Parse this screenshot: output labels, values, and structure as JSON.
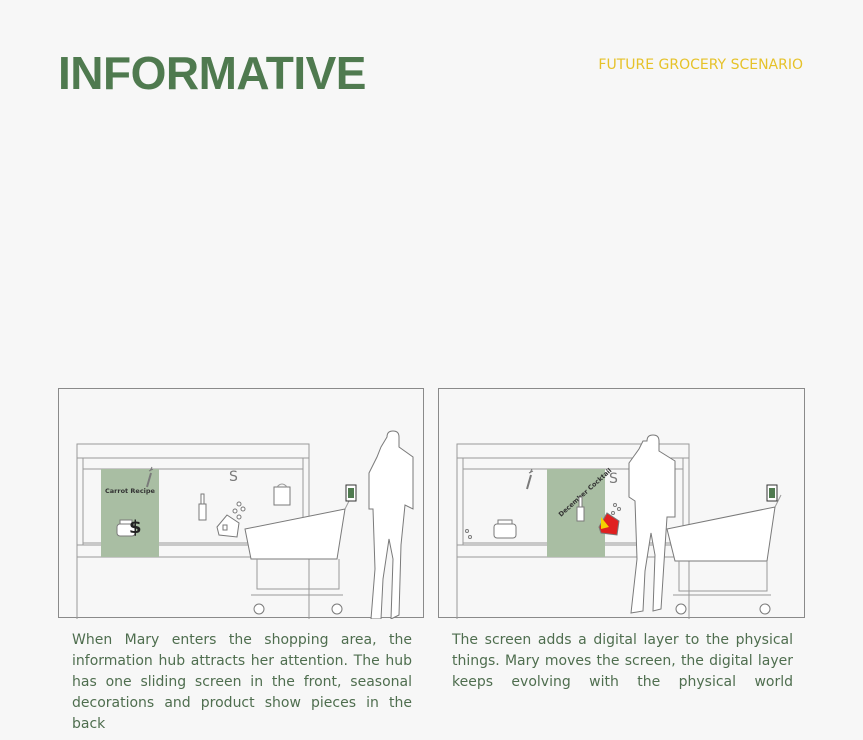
{
  "header": {
    "title": "INFORMATIVE",
    "subtitle": "FUTURE GROCERY SCENARIO"
  },
  "panels": [
    {
      "screen_label": "Carrot Recipe",
      "caption": "When Mary enters the shopping area, the information hub attracts her attention. The hub has one sliding screen in the front, seasonal decorations and product show pieces in the back"
    },
    {
      "screen_label": "December Cocktail",
      "caption": "The screen adds a digital layer to the physical things. Mary moves the screen, the digital layer keeps evolving with the physical world"
    }
  ],
  "colors": {
    "title": "#4f7a4f",
    "subtitle": "#e6c229",
    "screen": "#a9bea3",
    "caption": "#4f6e4f",
    "highlight_red": "#e02020",
    "highlight_yellow": "#f5d000",
    "phone": "#4f7a4f"
  }
}
